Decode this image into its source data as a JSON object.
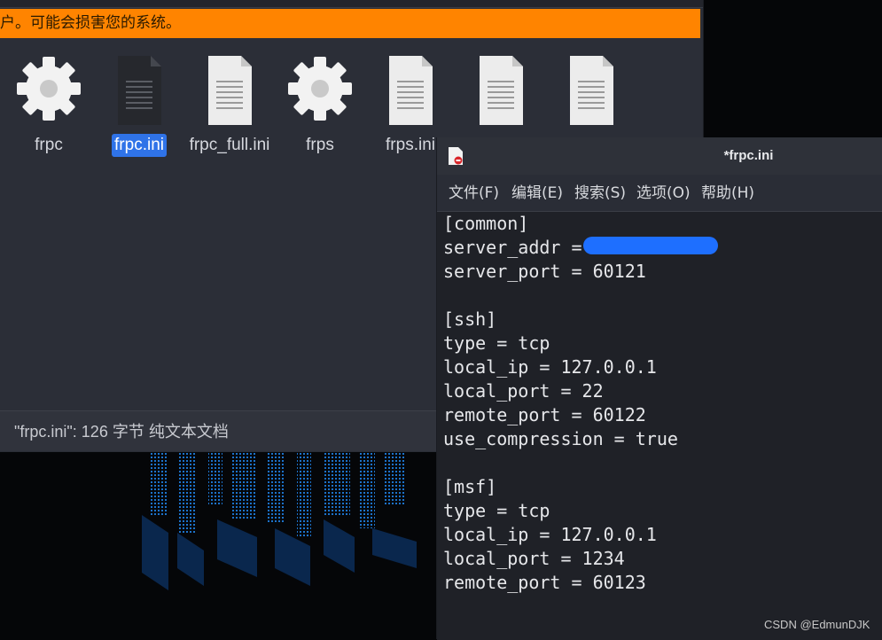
{
  "file_manager": {
    "warning_text": "户。可能会损害您的系统。",
    "files": [
      {
        "name": "frpc",
        "icon": "gear-icon",
        "selected": false
      },
      {
        "name": "frpc.ini",
        "icon": "text-file-icon",
        "selected": true
      },
      {
        "name": "frpc_full.ini",
        "icon": "text-file-icon",
        "selected": false
      },
      {
        "name": "frps",
        "icon": "gear-icon",
        "selected": false
      },
      {
        "name": "frps.ini",
        "icon": "text-file-icon",
        "selected": false
      },
      {
        "name": "",
        "icon": "text-file-icon",
        "selected": false
      },
      {
        "name": "",
        "icon": "text-file-icon",
        "selected": false
      }
    ],
    "status_text": "\"frpc.ini\": 126 字节 纯文本文档"
  },
  "editor": {
    "title": "*frpc.ini",
    "menu": [
      "文件(F)",
      "编辑(E)",
      "搜索(S)",
      "选项(O)",
      "帮助(H)"
    ],
    "lines": [
      "[common]",
      "server_addr = ",
      "server_port = 60121",
      "",
      "[ssh]",
      "type = tcp",
      "local_ip = 127.0.0.1",
      "local_port = 22",
      "remote_port = 60122",
      "use_compression = true",
      "",
      "[msf]",
      "type = tcp",
      "local_ip = 127.0.0.1",
      "local_port = 1234",
      "remote_port = 60123"
    ]
  },
  "watermark": "CSDN @EdmunDJK",
  "colors": {
    "warning": "#ff8400",
    "selection": "#2f73e8",
    "redaction": "#1e6fff"
  }
}
